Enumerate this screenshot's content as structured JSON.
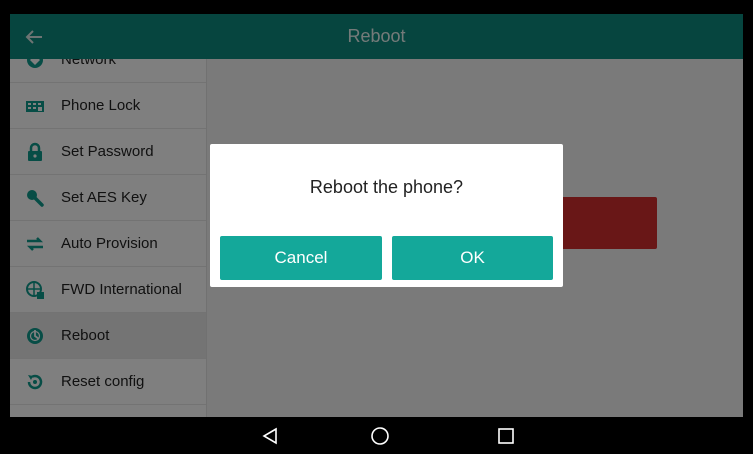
{
  "header": {
    "title": "Reboot",
    "back_icon": "arrow-left-icon"
  },
  "sidebar": {
    "items": [
      {
        "label": "Network",
        "icon": "network-icon"
      },
      {
        "label": "Phone Lock",
        "icon": "phone-lock-icon"
      },
      {
        "label": "Set Password",
        "icon": "lock-icon"
      },
      {
        "label": "Set AES Key",
        "icon": "key-icon"
      },
      {
        "label": "Auto Provision",
        "icon": "sync-arrows-icon"
      },
      {
        "label": "FWD International",
        "icon": "fwd-international-icon"
      },
      {
        "label": "Reboot",
        "icon": "reboot-icon",
        "selected": true
      },
      {
        "label": "Reset config",
        "icon": "reset-icon"
      }
    ]
  },
  "dialog": {
    "message": "Reboot the phone?",
    "cancel_label": "Cancel",
    "ok_label": "OK"
  },
  "navbar": {
    "icons": [
      "back-triangle-icon",
      "home-circle-icon",
      "recents-square-icon"
    ]
  },
  "colors": {
    "titlebar": "#0c8b7f",
    "accent": "#14a89a",
    "icon": "#0e9a8c",
    "danger": "#d32f2f"
  }
}
